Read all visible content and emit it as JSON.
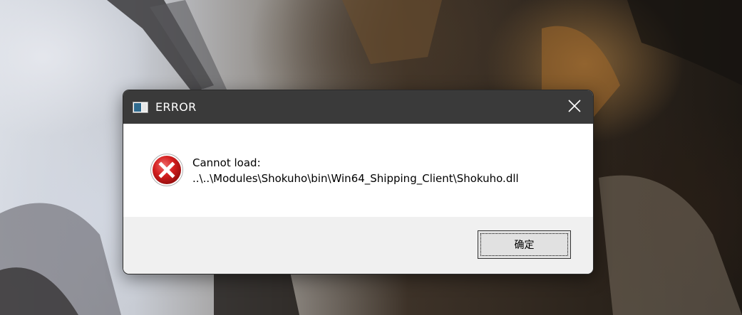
{
  "dialog": {
    "title": "ERROR",
    "title_icon": "window-app-icon",
    "close_icon": "close-icon",
    "error_icon": "error-icon",
    "message_line1": "Cannot load:",
    "message_line2": "..\\..\\Modules\\Shokuho\\bin\\Win64_Shipping_Client\\Shokuho.dll",
    "ok_label": "确定"
  },
  "colors": {
    "titlebar": "#3a3a3a",
    "content_bg": "#ffffff",
    "footer_bg": "#f0f0f0",
    "error_red": "#d21e1e"
  }
}
